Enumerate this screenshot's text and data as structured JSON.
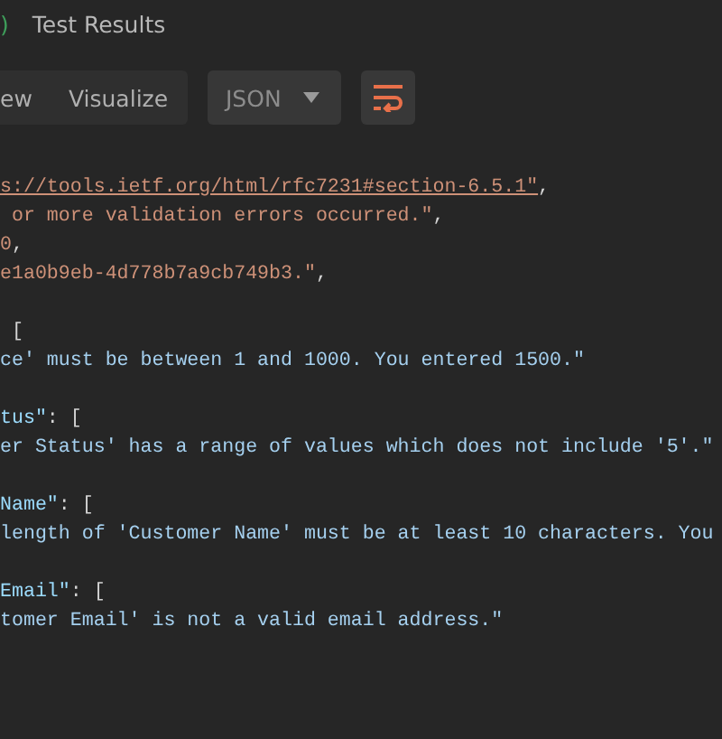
{
  "tabs": [
    {
      "label": ")",
      "kind": "count"
    },
    {
      "label": "Test Results",
      "kind": "plain"
    }
  ],
  "view_modes": [
    {
      "label": "ew",
      "selected": false
    },
    {
      "label": "Visualize",
      "selected": false
    }
  ],
  "format_dropdown": {
    "value": "JSON"
  },
  "wrap_toggle": {
    "on": true
  },
  "code_blocks": [
    {
      "lines": [
        {
          "segments": [
            {
              "text": "s://tools.ietf.org/html/rfc7231#section-6.5.1\"",
              "kind": "link"
            },
            {
              "text": ",",
              "kind": "punct"
            }
          ]
        },
        {
          "segments": [
            {
              "text": " or more validation errors occurred.\"",
              "kind": "string"
            },
            {
              "text": ",",
              "kind": "punct"
            }
          ]
        },
        {
          "segments": [
            {
              "text": "0",
              "kind": "number"
            },
            {
              "text": ",",
              "kind": "punct"
            }
          ]
        },
        {
          "segments": [
            {
              "text": "e1a0b9eb-4d778b7a9cb749b3.\"",
              "kind": "string"
            },
            {
              "text": ",",
              "kind": "punct"
            }
          ]
        }
      ]
    },
    {
      "lines": [
        {
          "segments": [
            {
              "text": " [",
              "kind": "punct"
            }
          ]
        },
        {
          "segments": [
            {
              "text": "ce' must be between 1 and 1000. You entered 1500.\"",
              "kind": "message"
            }
          ]
        }
      ]
    },
    {
      "lines": [
        {
          "segments": [
            {
              "text": "tus\"",
              "kind": "key"
            },
            {
              "text": ": [",
              "kind": "punct"
            }
          ]
        },
        {
          "segments": [
            {
              "text": "er Status' has a range of values which does not include '5'.\"",
              "kind": "message"
            }
          ]
        }
      ]
    },
    {
      "lines": [
        {
          "segments": [
            {
              "text": "Name\"",
              "kind": "key"
            },
            {
              "text": ": [",
              "kind": "punct"
            }
          ]
        },
        {
          "segments": [
            {
              "text": "length of 'Customer Name' must be at least 10 characters. You",
              "kind": "message"
            }
          ]
        }
      ]
    },
    {
      "lines": [
        {
          "segments": [
            {
              "text": "Email\"",
              "kind": "key"
            },
            {
              "text": ": [",
              "kind": "punct"
            }
          ]
        },
        {
          "segments": [
            {
              "text": "tomer Email' is not a valid email address.\"",
              "kind": "message"
            }
          ]
        }
      ]
    }
  ]
}
